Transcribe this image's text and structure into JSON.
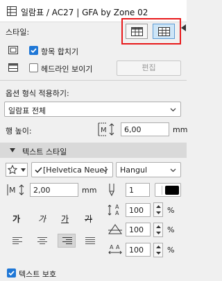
{
  "window": {
    "title": "일람표 / AC27 | GFA by Zone 02"
  },
  "style": {
    "label": "스타일:",
    "merge_items_label": "항목 합치기",
    "merge_items_checked": true,
    "show_headline_label": "헤드라인 보이기",
    "show_headline_checked": false,
    "edit_label": "편집"
  },
  "apply_format": {
    "label": "옵션 형식 적용하기:",
    "selected": "일람표 전체"
  },
  "row_height": {
    "label": "행 높이:",
    "value": "6,00",
    "unit": "mm"
  },
  "text_style": {
    "section_label": "텍스트 스타일",
    "font": "[Helvetica Neue]",
    "script": "Hangul",
    "size": "2,00",
    "size_unit": "mm",
    "pen": "1",
    "styles": [
      "가",
      "가",
      "가",
      "가"
    ],
    "width_pct": "100",
    "spacing_pct": "100",
    "slant_pct": "100",
    "pct_unit": "%"
  },
  "text_protection": {
    "label": "텍스트 보호",
    "checked": true
  },
  "colors": {
    "accent": "#1f77d6",
    "highlight": "#e8191b"
  }
}
